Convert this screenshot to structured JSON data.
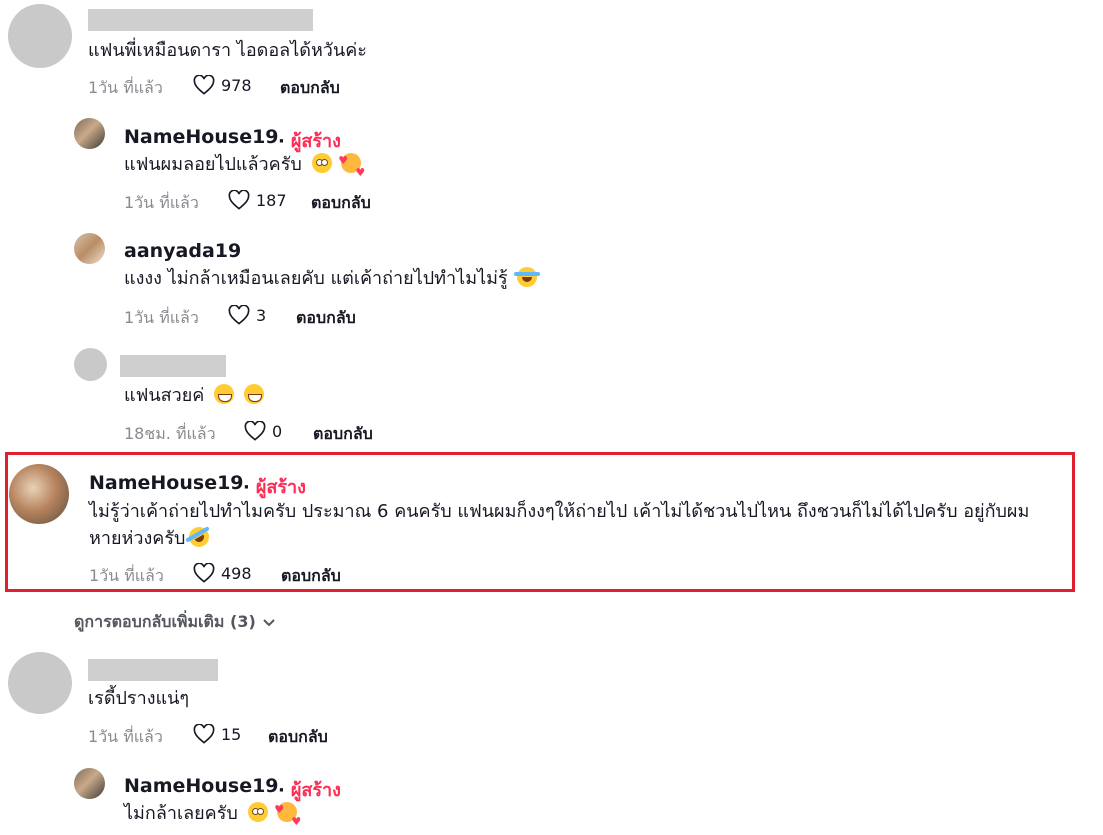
{
  "comments": {
    "c1": {
      "text": "แฟนพี่เหมือนดารา ไอดอลได้หวันค่ะ",
      "time": "1วัน ที่แล้ว",
      "likes": "978",
      "reply": "ตอบกลับ"
    },
    "r1": {
      "username": "NameHouse19",
      "creator": "ผู้สร้าง",
      "text": "แฟนผมลอยไปแล้วครับ",
      "emojis": [
        "flushed-face-emoji",
        "smiling-face-with-hearts-emoji"
      ],
      "time": "1วัน ที่แล้ว",
      "likes": "187",
      "reply": "ตอบกลับ"
    },
    "r2": {
      "username": "aanyada19",
      "text": "แงงง ไม่กล้าเหมือนเลยคับ แต่เค้าถ่ายไปทำไมไม่รู้",
      "emojis": [
        "face-with-tears-of-joy-emoji"
      ],
      "time": "1วัน ที่แล้ว",
      "likes": "3",
      "reply": "ตอบกลับ"
    },
    "r3": {
      "text": "แฟนสวยค่",
      "emojis": [
        "grinning-face-emoji",
        "grinning-face-emoji"
      ],
      "time": "18ชม. ที่แล้ว",
      "likes": "0",
      "reply": "ตอบกลับ"
    },
    "r4": {
      "username": "NameHouse19",
      "creator": "ผู้สร้าง",
      "text_line1": "ไม่รู้ว่าเค้าถ่ายไปทำไมครับ ประมาณ 6 คนครับ แฟนผมก็งงๆให้ถ่ายไป เค้าไม่ได้ชวนไปไหน ถึงชวนก็ไม่ได้ไปครับ อยู่กับผม",
      "text_line2": "หายห่วงครับ",
      "emojis": [
        "rolling-on-floor-laughing-emoji"
      ],
      "time": "1วัน ที่แล้ว",
      "likes": "498",
      "reply": "ตอบกลับ"
    },
    "more_replies": "ดูการตอบกลับเพิ่มเติม (3)",
    "c2": {
      "text": "เรดี้ปรางแน่ๆ",
      "time": "1วัน ที่แล้ว",
      "likes": "15",
      "reply": "ตอบกลับ"
    },
    "r5": {
      "username": "NameHouse19",
      "creator": "ผู้สร้าง",
      "text": "ไม่กล้าเลยครับ",
      "emojis": [
        "flushed-face-emoji",
        "smiling-face-with-hearts-emoji"
      ]
    }
  },
  "colors": {
    "creator": "#fe2c55",
    "highlight_border": "#e0202f",
    "meta": "#8a8b91"
  }
}
